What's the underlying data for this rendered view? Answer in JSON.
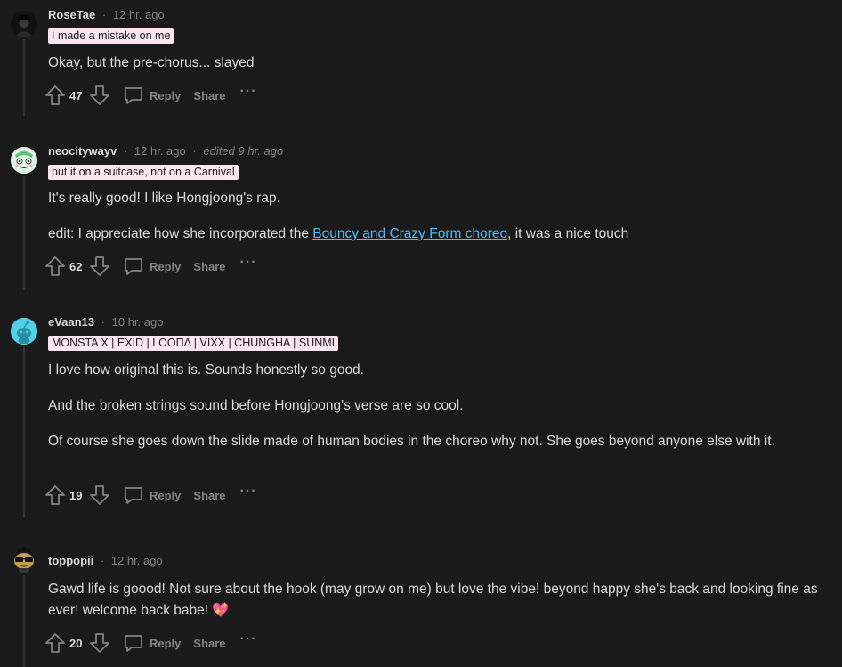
{
  "actions": {
    "reply_label": "Reply",
    "share_label": "Share",
    "more_label": "···"
  },
  "comments": [
    {
      "author": "RoseTae",
      "time": "12 hr. ago",
      "edited": "",
      "flair": "I made a mistake on me",
      "paragraphs": [
        "Okay, but the pre-chorus... slayed"
      ],
      "votes": "47",
      "avatar_icon": "dark-portrait-avatar"
    },
    {
      "author": "neocitywayv",
      "time": "12 hr. ago",
      "edited": "edited 9 hr. ago",
      "flair": "put it on a suitcase, not on a Carnival",
      "paragraphs": [
        "It's really good! I like Hongjoong's rap."
      ],
      "edit_line": {
        "before": "edit: I appreciate how she incorporated the ",
        "link": "Bouncy and Crazy Form choreo",
        "after": ", it was a nice touch"
      },
      "votes": "62",
      "avatar_icon": "green-cartoon-avatar"
    },
    {
      "author": "eVaan13",
      "time": "10 hr. ago",
      "edited": "",
      "flair": "MONSTA X | EXID | LOOΠΔ | VIXX | CHUNGHA | SUNMI",
      "paragraphs": [
        "I love how original this is. Sounds honestly so good.",
        "And the broken strings sound before Hongjoong's verse are so cool.",
        "Of course she goes down the slide made of human bodies in the choreo why not. She goes beyond anyone else with it."
      ],
      "votes": "19",
      "avatar_icon": "cyan-snoo-avatar"
    },
    {
      "author": "toppopii",
      "time": "12 hr. ago",
      "edited": "",
      "flair": "",
      "paragraphs": [
        "Gawd life is goood! Not sure about the hook (may grow on me) but love the vibe! beyond happy she's back and looking fine as ever! welcome back babe! 💖"
      ],
      "votes": "20",
      "avatar_icon": "sunglasses-snoo-avatar"
    }
  ]
}
